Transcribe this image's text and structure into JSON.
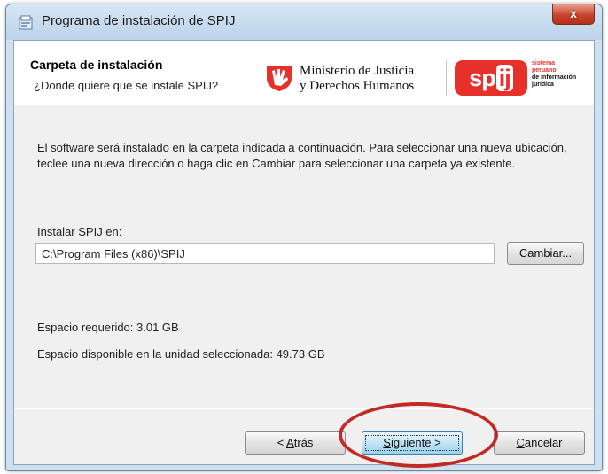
{
  "window": {
    "title": "Programa de instalación de SPIJ",
    "close_label": "x"
  },
  "header": {
    "title": "Carpeta de instalación",
    "subtitle": "¿Donde quiere que se instale SPIJ?",
    "ministry_line1": "Ministerio de Justicia",
    "ministry_line2": "y Derechos Humanos",
    "spij_logo_sp": "sp",
    "spij_logo_ij": "ij",
    "spij_tagline": [
      "sistema",
      "peruano",
      "de información",
      "jurídica"
    ]
  },
  "body": {
    "description": "El software será instalado en la carpeta indicada a continuación. Para seleccionar una nueva ubicación, teclee una nueva dirección o haga clic en Cambiar para seleccionar una carpeta ya existente.",
    "install_label": "Instalar SPIJ en:",
    "install_path": "C:\\Program Files (x86)\\SPIJ",
    "change_button": "Cambiar...",
    "space_required": "Espacio requerido: 3.01 GB",
    "space_available": "Espacio disponible en la unidad seleccionada: 49.73 GB"
  },
  "footer": {
    "back_prefix": "< ",
    "back_mnemonic": "A",
    "back_rest": "trás",
    "next_mnemonic": "S",
    "next_rest": "iguiente >",
    "cancel_mnemonic": "C",
    "cancel_rest": "ancelar"
  },
  "colors": {
    "accent_red": "#e8302a",
    "highlight_ring": "#c22b24",
    "window_frame": "#cfe0f0"
  }
}
